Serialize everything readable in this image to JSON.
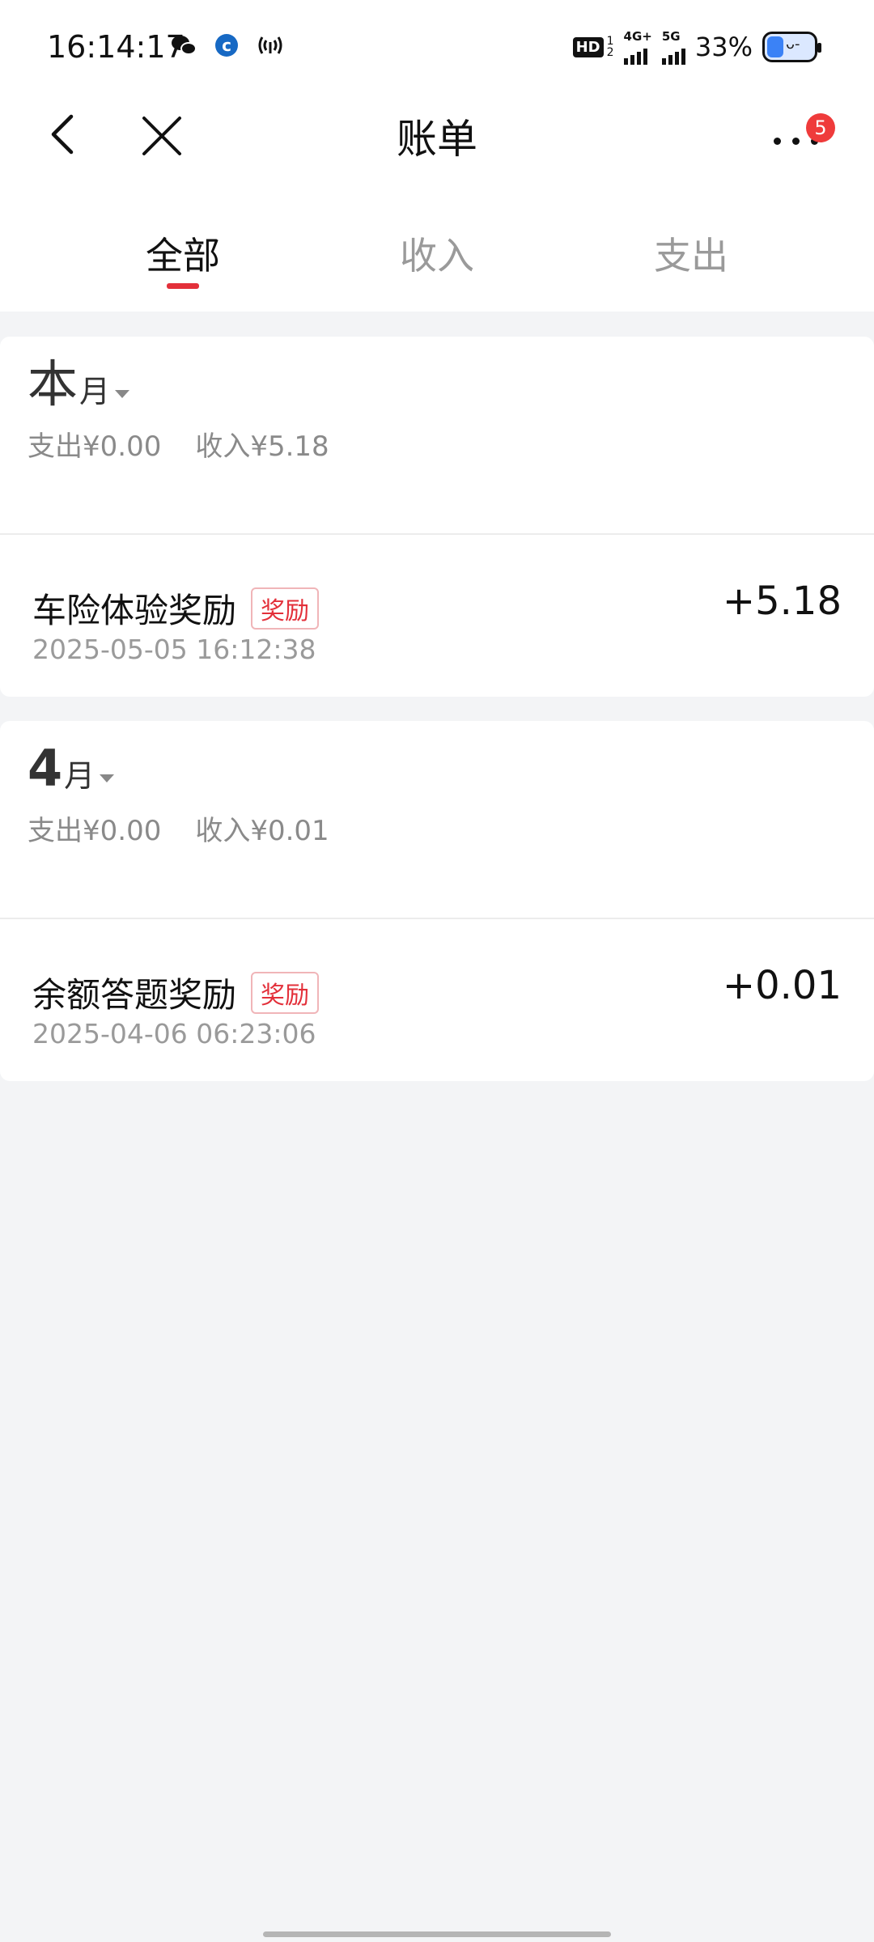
{
  "status_bar": {
    "time": "16:14:17",
    "hd_label": "HD",
    "hd_sub_top": "1",
    "hd_sub_bottom": "2",
    "net1": "4G+",
    "net2": "5G",
    "battery": "33%"
  },
  "header": {
    "title": "账单",
    "badge_count": "5"
  },
  "tabs": [
    {
      "label": "全部",
      "active": true
    },
    {
      "label": "收入",
      "active": false
    },
    {
      "label": "支出",
      "active": false
    }
  ],
  "months": [
    {
      "label_big": "本",
      "label_small": "月",
      "expense": "支出¥0.00",
      "income": "收入¥5.18",
      "transactions": [
        {
          "title": "车险体验奖励",
          "tag": "奖励",
          "time": "2025-05-05 16:12:38",
          "amount": "+5.18"
        }
      ]
    },
    {
      "label_big": "4",
      "label_small": "月",
      "expense": "支出¥0.00",
      "income": "收入¥0.01",
      "transactions": [
        {
          "title": "余额答题奖励",
          "tag": "奖励",
          "time": "2025-04-06 06:23:06",
          "amount": "+0.01"
        }
      ]
    }
  ],
  "colors": {
    "accent_red": "#e3303a",
    "badge_red": "#ef3b3b",
    "background": "#f3f4f6"
  }
}
